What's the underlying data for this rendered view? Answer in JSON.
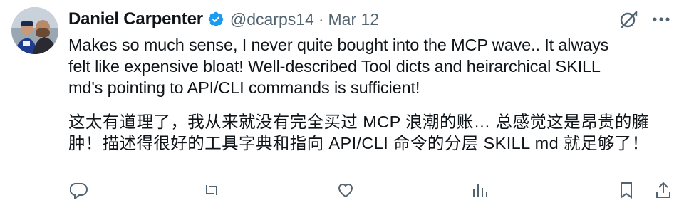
{
  "tweet": {
    "author": {
      "display_name": "Daniel Carpenter",
      "handle": "@dcarps14",
      "verified": true,
      "avatar": "avatar-photo"
    },
    "separator": "·",
    "timestamp": "Mar 12",
    "text_en": "Makes so much sense, I never quite bought into the MCP wave.. It always\nfelt like expensive bloat! Well-described Tool dicts and heirarchical SKILL\nmd's pointing to API/CLI commands is sufficient!",
    "text_zh": "这太有道理了，我从来就没有完全买过 MCP 浪潮的账… 总感觉这是昂贵的臃\n肿！描述得很好的工具字典和指向 API/CLI 命令的分层 SKILL md 就足够了！",
    "header_icons": [
      "grok-icon",
      "more-icon"
    ],
    "action_icons": [
      "reply-icon",
      "repost-icon",
      "like-icon",
      "views-icon",
      "bookmark-icon",
      "share-icon"
    ]
  },
  "colors": {
    "text_primary": "#0f1419",
    "text_secondary": "#536471",
    "verified_badge": "#1d9bf0",
    "background": "#ffffff"
  }
}
